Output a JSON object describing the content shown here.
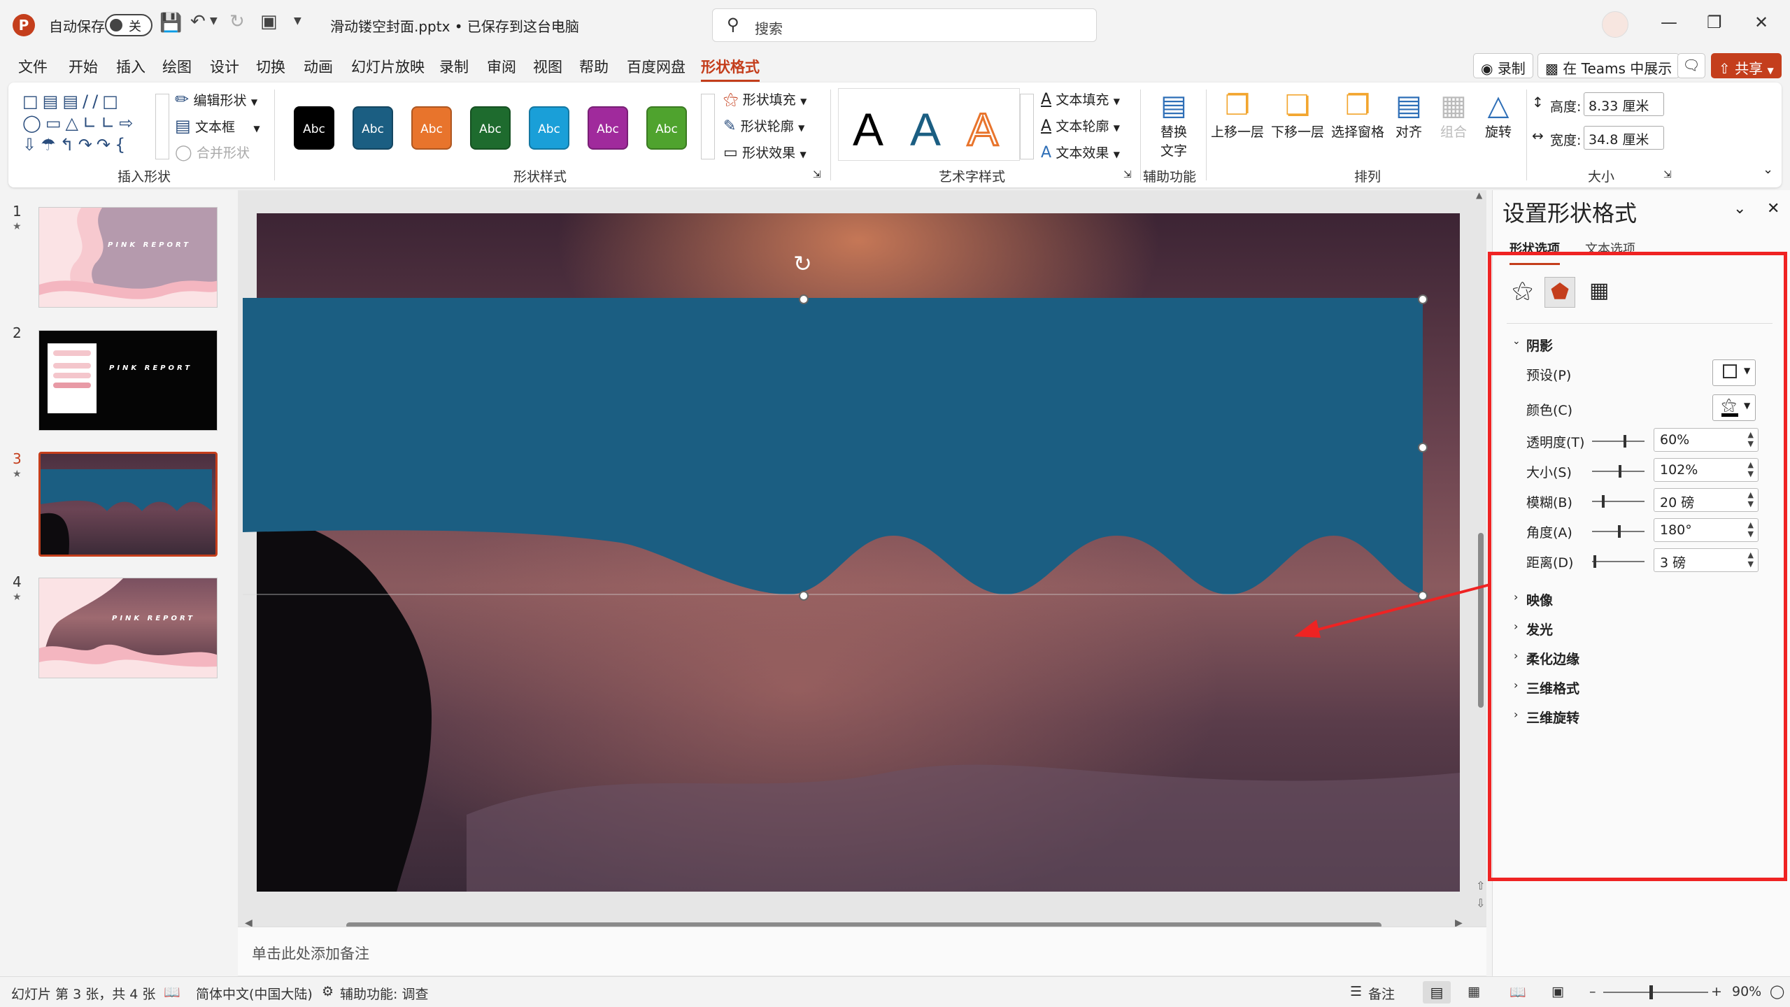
{
  "app": {
    "autosave_label": "自动保存",
    "autosave_state": "关",
    "file_title": "滑动镂空封面.pptx • 已保存到这台电脑",
    "search_placeholder": "搜索"
  },
  "menu": {
    "items": [
      "文件",
      "开始",
      "插入",
      "绘图",
      "设计",
      "切换",
      "动画",
      "幻灯片放映",
      "录制",
      "审阅",
      "视图",
      "帮助",
      "百度网盘",
      "形状格式"
    ],
    "record_label": "录制",
    "teams_label": "在 Teams 中展示",
    "share_label": "共享"
  },
  "ribbon": {
    "insert_shapes": {
      "edit_shape": "编辑形状",
      "text_box": "文本框",
      "merge_shapes": "合并形状",
      "group_label": "插入形状"
    },
    "shape_styles": {
      "swatches": [
        {
          "label": "Abc",
          "color": "#000000"
        },
        {
          "label": "Abc",
          "color": "#1b5e82"
        },
        {
          "label": "Abc",
          "color": "#e8742c"
        },
        {
          "label": "Abc",
          "color": "#1e6b2e"
        },
        {
          "label": "Abc",
          "color": "#1a9fd8"
        },
        {
          "label": "Abc",
          "color": "#a02a9c"
        },
        {
          "label": "Abc",
          "color": "#4fa32e"
        }
      ],
      "fill": "形状填充",
      "outline": "形状轮廓",
      "effects": "形状效果",
      "group_label": "形状样式"
    },
    "wordart": {
      "letters": [
        "A",
        "A",
        "A"
      ],
      "text_fill": "文本填充",
      "text_outline": "文本轮廓",
      "text_effects": "文本效果",
      "group_label": "艺术字样式"
    },
    "accessibility": {
      "alt_text_line1": "替换",
      "alt_text_line2": "文字",
      "group_label": "辅助功能"
    },
    "arrange": {
      "bring_forward": "上移一层",
      "send_backward": "下移一层",
      "selection_pane": "选择窗格",
      "align": "对齐",
      "group": "组合",
      "rotate": "旋转",
      "group_label": "排列"
    },
    "size": {
      "height_label": "高度:",
      "height_value": "8.33 厘米",
      "width_label": "宽度:",
      "width_value": "34.8 厘米",
      "group_label": "大小"
    }
  },
  "slides": [
    {
      "num": "1",
      "title": "PINK REPORT"
    },
    {
      "num": "2",
      "title": "PINK REPORT"
    },
    {
      "num": "3",
      "title": ""
    },
    {
      "num": "4",
      "title": "PINK REPORT"
    }
  ],
  "notes_placeholder": "单击此处添加备注",
  "pane": {
    "title": "设置形状格式",
    "tab_shape": "形状选项",
    "tab_text": "文本选项",
    "shadow_header": "阴影",
    "preset_label": "预设(P)",
    "color_label": "颜色(C)",
    "transparency_label": "透明度(T)",
    "transparency_value": "60%",
    "transparency_level": 0.6,
    "size_label": "大小(S)",
    "size_value": "102%",
    "blur_label": "模糊(B)",
    "blur_value": "20 磅",
    "angle_label": "角度(A)",
    "angle_value": "180°",
    "distance_label": "距离(D)",
    "distance_value": "3 磅",
    "reflection": "映像",
    "glow": "发光",
    "soft_edges": "柔化边缘",
    "format_3d": "三维格式",
    "rotation_3d": "三维旋转"
  },
  "status": {
    "slide_info": "幻灯片 第 3 张，共 4 张",
    "language": "简体中文(中国大陆)",
    "accessibility": "辅助功能: 调查",
    "notes": "备注",
    "zoom": "90%"
  },
  "colors": {
    "accent": "#c43e1c",
    "shape_fill": "#1b5e82",
    "annotation_red": "#ef2323"
  }
}
